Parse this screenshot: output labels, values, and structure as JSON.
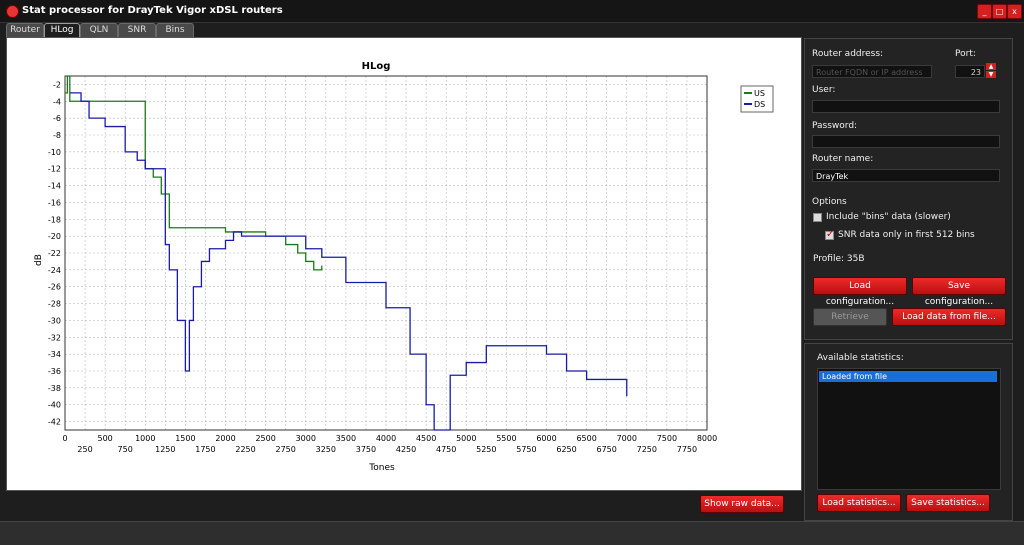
{
  "window": {
    "title": "Stat processor for DrayTek Vigor xDSL routers",
    "min": "_",
    "max": "□",
    "close": "x"
  },
  "tabs": [
    "Router",
    "HLog",
    "QLN",
    "SNR",
    "Bins"
  ],
  "active_tab": "HLog",
  "chart_data": {
    "type": "line",
    "title": "HLog",
    "xlabel": "Tones",
    "ylabel": "dB",
    "xlim": [
      0,
      8000
    ],
    "ylim": [
      -43,
      -1
    ],
    "x_ticks_top": [
      0,
      500,
      1000,
      1500,
      2000,
      2500,
      3000,
      3500,
      4000,
      4500,
      5000,
      5500,
      6000,
      6500,
      7000,
      7500,
      8000
    ],
    "x_ticks_bottom": [
      250,
      750,
      1250,
      1750,
      2250,
      2750,
      3250,
      3750,
      4250,
      4750,
      5250,
      5750,
      6250,
      6750,
      7250,
      7750
    ],
    "y_ticks": [
      -2,
      -4,
      -6,
      -8,
      -10,
      -12,
      -14,
      -16,
      -18,
      -20,
      -22,
      -24,
      -26,
      -28,
      -30,
      -32,
      -34,
      -36,
      -38,
      -40,
      -42
    ],
    "grid": true,
    "legend_position": "top-right",
    "series": [
      {
        "name": "US",
        "color": "#1a7a1a",
        "x": [
          0,
          30,
          60,
          1000,
          1100,
          1200,
          1300,
          2000,
          2250,
          2500,
          2750,
          2900,
          3000,
          3100,
          3200
        ],
        "y": [
          -3,
          -1,
          -4,
          -12,
          -13,
          -15,
          -19,
          -19.5,
          -19.5,
          -20,
          -21,
          -22,
          -23,
          -24,
          -23.5
        ]
      },
      {
        "name": "DS",
        "color": "#1a1aa8",
        "x": [
          60,
          200,
          300,
          500,
          750,
          900,
          1000,
          1250,
          1300,
          1400,
          1500,
          1550,
          1600,
          1700,
          1800,
          2000,
          2100,
          2200,
          3000,
          3200,
          3500,
          4000,
          4300,
          4500,
          4600,
          4800,
          5000,
          5250,
          5500,
          5750,
          6000,
          6250,
          6500,
          7000
        ],
        "y": [
          -3,
          -4,
          -6,
          -7,
          -10,
          -11,
          -12,
          -21,
          -24,
          -30,
          -36,
          -30,
          -26,
          -23,
          -21.5,
          -20.5,
          -19.5,
          -20,
          -21.5,
          -22.5,
          -25.5,
          -28.5,
          -34,
          -40,
          -43,
          -36.5,
          -35,
          -33,
          -33,
          -33,
          -34,
          -36,
          -37,
          -39
        ]
      }
    ]
  },
  "raw_button": "Show raw data...",
  "side": {
    "router_address_label": "Router address:",
    "router_address_placeholder": "Router FQDN or IP address",
    "port_label": "Port:",
    "port_value": "23",
    "user_label": "User:",
    "user_value": "",
    "password_label": "Password:",
    "password_value": "",
    "router_name_label": "Router name:",
    "router_name_value": "DrayTek",
    "options_label": "Options",
    "opt_bins": "Include \"bins\" data (slower)",
    "opt_snr": "SNR data only in first 512 bins",
    "opt_bins_checked": false,
    "opt_snr_checked": true,
    "profile": "Profile: 35B",
    "load_config": "Load configuration...",
    "save_config": "Save configuration...",
    "retrieve": "Retrieve",
    "load_file": "Load data from file..."
  },
  "stats": {
    "label": "Available statistics:",
    "items": [
      "Loaded from file"
    ],
    "load": "Load statistics...",
    "save": "Save statistics..."
  }
}
